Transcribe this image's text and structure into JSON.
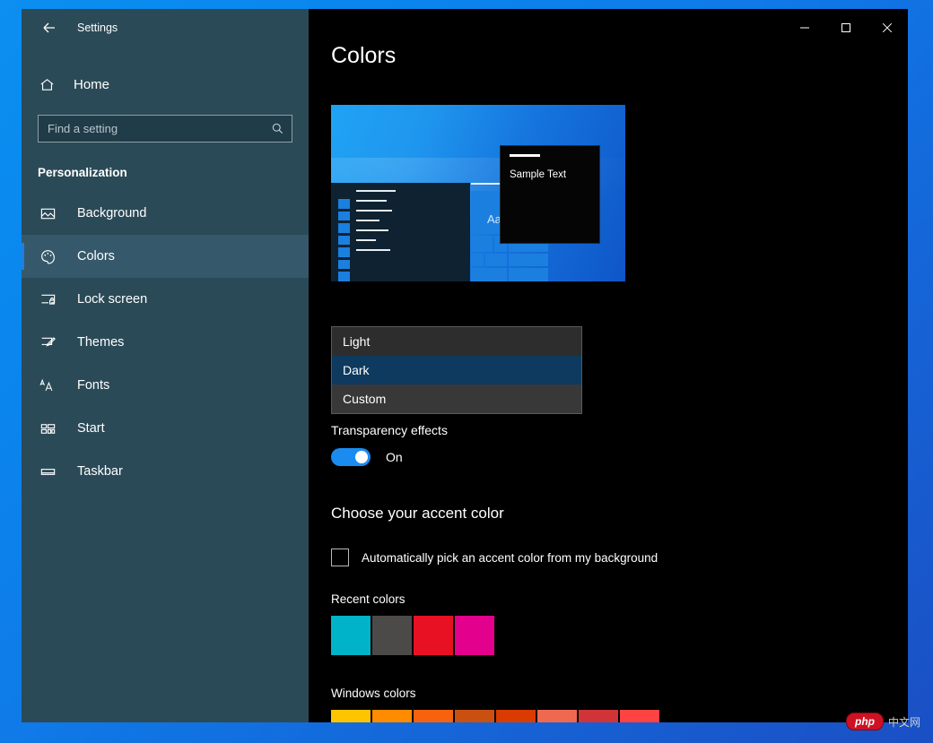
{
  "desktop": {
    "background_color": "#0b8ff0"
  },
  "window": {
    "title": "Settings",
    "back_icon": "back-arrow-icon",
    "controls": {
      "minimize": "minimize-icon",
      "maximize": "maximize-icon",
      "close": "close-icon"
    }
  },
  "sidebar": {
    "home": {
      "label": "Home",
      "icon": "home-icon"
    },
    "search": {
      "placeholder": "Find a setting",
      "value": "",
      "icon": "search-icon"
    },
    "category": "Personalization",
    "items": [
      {
        "label": "Background",
        "icon": "image-icon",
        "selected": false
      },
      {
        "label": "Colors",
        "icon": "palette-icon",
        "selected": true
      },
      {
        "label": "Lock screen",
        "icon": "lock-screen-icon",
        "selected": false
      },
      {
        "label": "Themes",
        "icon": "themes-brush-icon",
        "selected": false
      },
      {
        "label": "Fonts",
        "icon": "fonts-aa-icon",
        "selected": false
      },
      {
        "label": "Start",
        "icon": "start-tiles-icon",
        "selected": false
      },
      {
        "label": "Taskbar",
        "icon": "taskbar-icon",
        "selected": false
      }
    ],
    "accent_bar_color": "#1e7fe0",
    "background_color": "#2b4a57"
  },
  "main": {
    "page_title": "Colors",
    "preview": {
      "sample_text": "Sample Text",
      "tile_text": "Aa"
    },
    "color_mode_dropdown": {
      "options": [
        {
          "label": "Light",
          "selected": false
        },
        {
          "label": "Dark",
          "selected": true
        },
        {
          "label": "Custom",
          "selected": false
        }
      ],
      "highlight_color": "#0d3a5e"
    },
    "transparency": {
      "label": "Transparency effects",
      "state": "On",
      "on_color": "#1a8cf0"
    },
    "accent": {
      "heading": "Choose your accent color",
      "auto_pick_label": "Automatically pick an accent color from my background",
      "auto_pick_checked": false,
      "recent_colors_label": "Recent colors",
      "recent_colors": [
        "#00b3c8",
        "#4c4a48",
        "#e81123",
        "#e3008c"
      ],
      "windows_colors_label": "Windows colors",
      "windows_colors": [
        "#ffc400",
        "#ff8c00",
        "#f7630c",
        "#ca5010",
        "#da3b01",
        "#ef6950",
        "#d13438",
        "#ff4343"
      ]
    }
  },
  "watermark": {
    "badge": "php",
    "text": "中文网"
  }
}
